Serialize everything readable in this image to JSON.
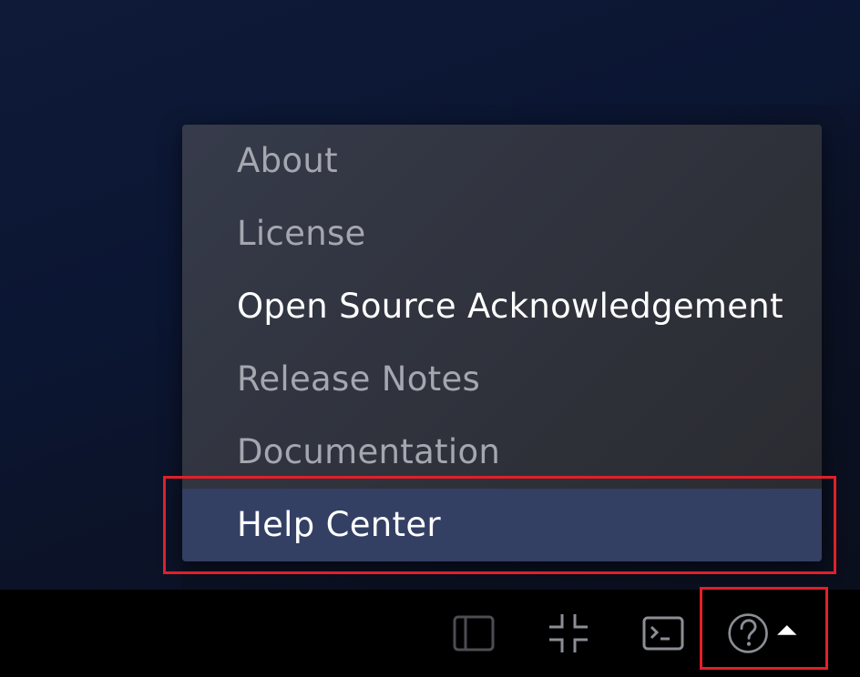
{
  "help_menu": {
    "items": [
      {
        "label": "About",
        "state": "normal"
      },
      {
        "label": "License",
        "state": "normal"
      },
      {
        "label": "Open Source Acknowledgement",
        "state": "hover"
      },
      {
        "label": "Release Notes",
        "state": "normal"
      },
      {
        "label": "Documentation",
        "state": "normal"
      },
      {
        "label": "Help Center",
        "state": "selected"
      }
    ]
  },
  "toolbar": {
    "buttons": [
      {
        "name": "sidebar-toggle",
        "icon": "sidebar-panel-icon"
      },
      {
        "name": "collapse",
        "icon": "collapse-arrows-icon"
      },
      {
        "name": "terminal",
        "icon": "terminal-icon"
      },
      {
        "name": "help",
        "icon": "question-circle-icon",
        "dropdown": "caret-up-icon"
      }
    ]
  },
  "colors": {
    "menu_selected_bg": "#333f63",
    "highlight_border": "#e0202a",
    "menu_text_dim": "#a4a7af",
    "menu_text_bright": "#ffffff"
  }
}
